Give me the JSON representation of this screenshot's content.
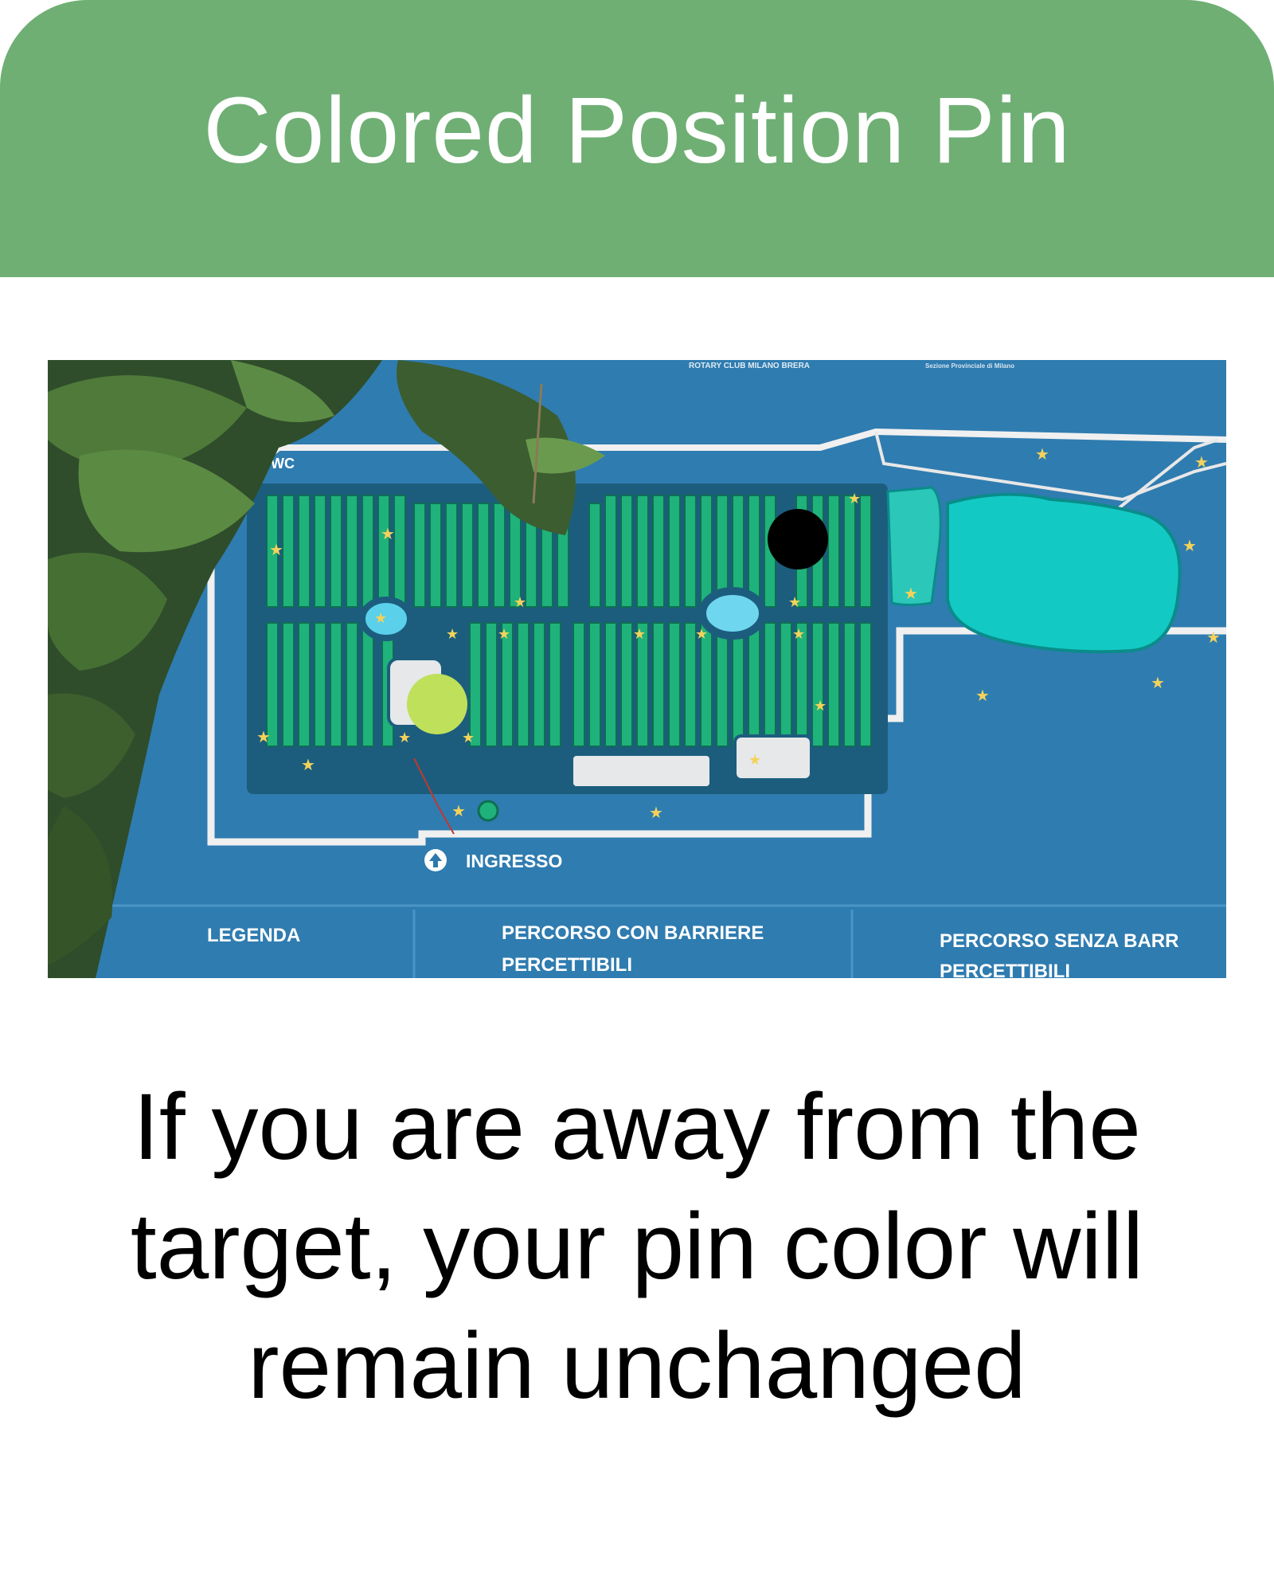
{
  "header": {
    "title": "Colored Position Pin"
  },
  "map": {
    "top_credits": [
      "ROTARY CLUB MILANO BRERA",
      "Sezione Provinciale di Milano"
    ],
    "wc_label": "WC",
    "entrance_label": "INGRESSO",
    "legend": {
      "title": "LEGENDA",
      "col1_line1": "PERCORSO CON BARRIERE",
      "col1_line2": "PERCETTIBILI",
      "col2_line1": "PERCORSO SENZA BARR",
      "col2_line2": "PERCETTIBILI"
    },
    "pins": [
      {
        "name": "target-pin",
        "color": "#000000"
      },
      {
        "name": "user-position-pin",
        "color": "#bfe05a"
      }
    ],
    "colors": {
      "map_background": "#2a78ad",
      "garden_beds": "#1fb27a",
      "pond": "#13c9c4",
      "path": "#f3f3f3"
    }
  },
  "caption": {
    "text": "If you are away from the target, your pin color will remain unchanged"
  },
  "colors": {
    "header_bg": "#6faf74",
    "header_text": "#ffffff",
    "caption_text": "#000000"
  }
}
